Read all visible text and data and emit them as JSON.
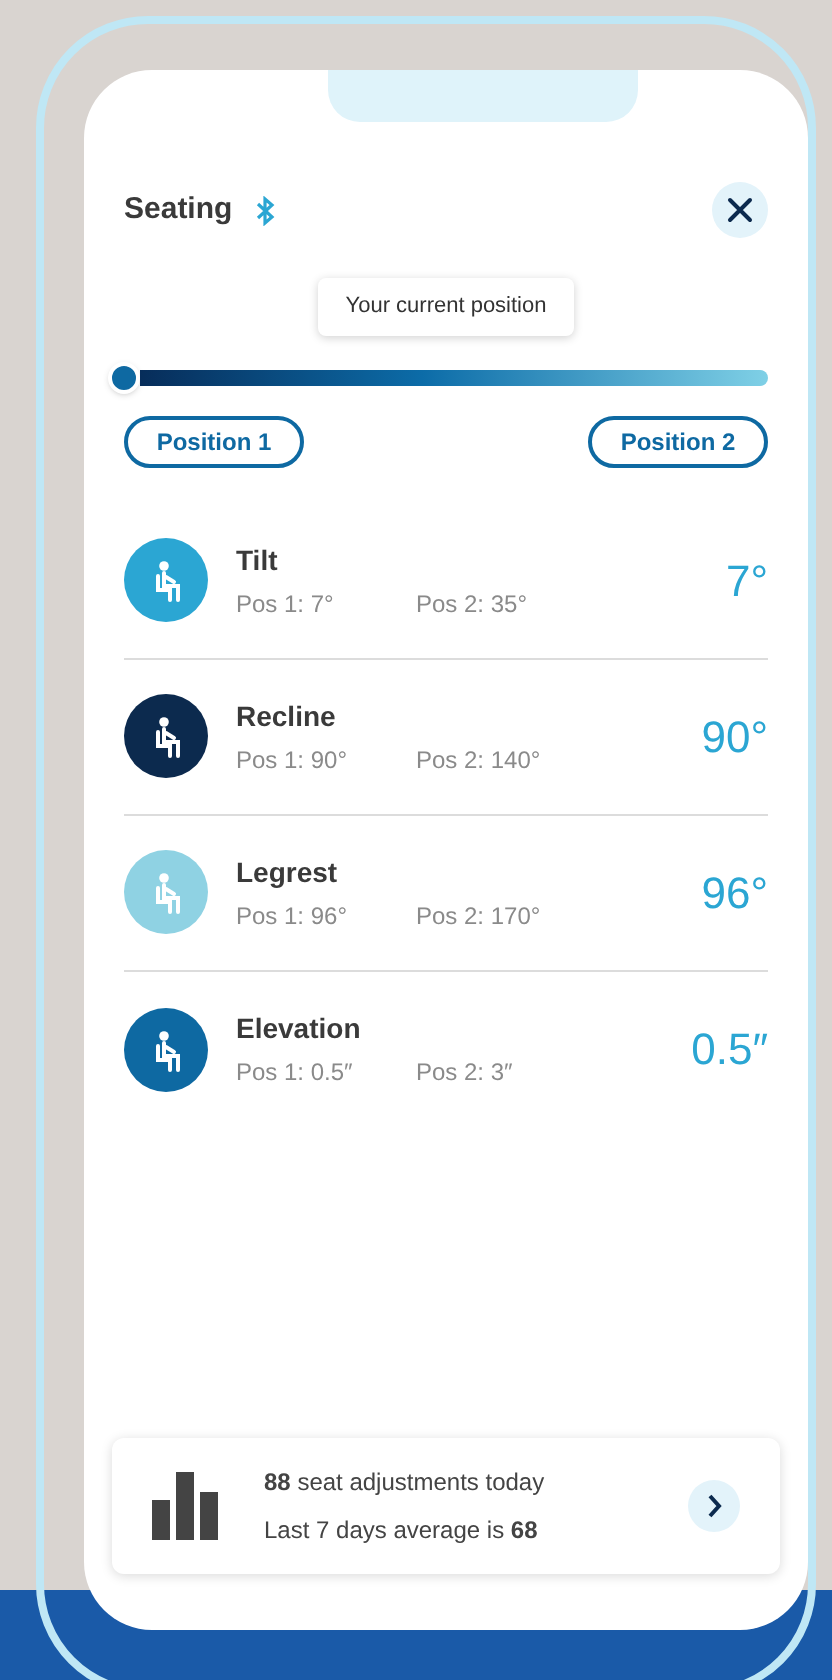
{
  "header": {
    "title": "Seating",
    "bluetooth": true
  },
  "slider": {
    "tooltip": "Your current position",
    "level": 0
  },
  "positions": [
    "Position 1",
    "Position 2"
  ],
  "settings": [
    {
      "name": "Tilt",
      "pos1": "Pos 1: 7°",
      "pos2": "Pos 2: 35°",
      "value": "7°",
      "color": "#2ba6d3"
    },
    {
      "name": "Recline",
      "pos1": "Pos 1: 90°",
      "pos2": "Pos 2: 140°",
      "value": "90°",
      "color": "#0c2a4e"
    },
    {
      "name": "Legrest",
      "pos1": "Pos 1: 96°",
      "pos2": "Pos 2: 170°",
      "value": "96°",
      "color": "#8fd2e3"
    },
    {
      "name": "Elevation",
      "pos1": "Pos 1: 0.5″",
      "pos2": "Pos 2: 3″",
      "value": "0.5″",
      "color": "#0e69a2"
    }
  ],
  "summary": {
    "line_1": "**88** seat adjustments today",
    "line_2": "Last 7 days average is **68**"
  }
}
